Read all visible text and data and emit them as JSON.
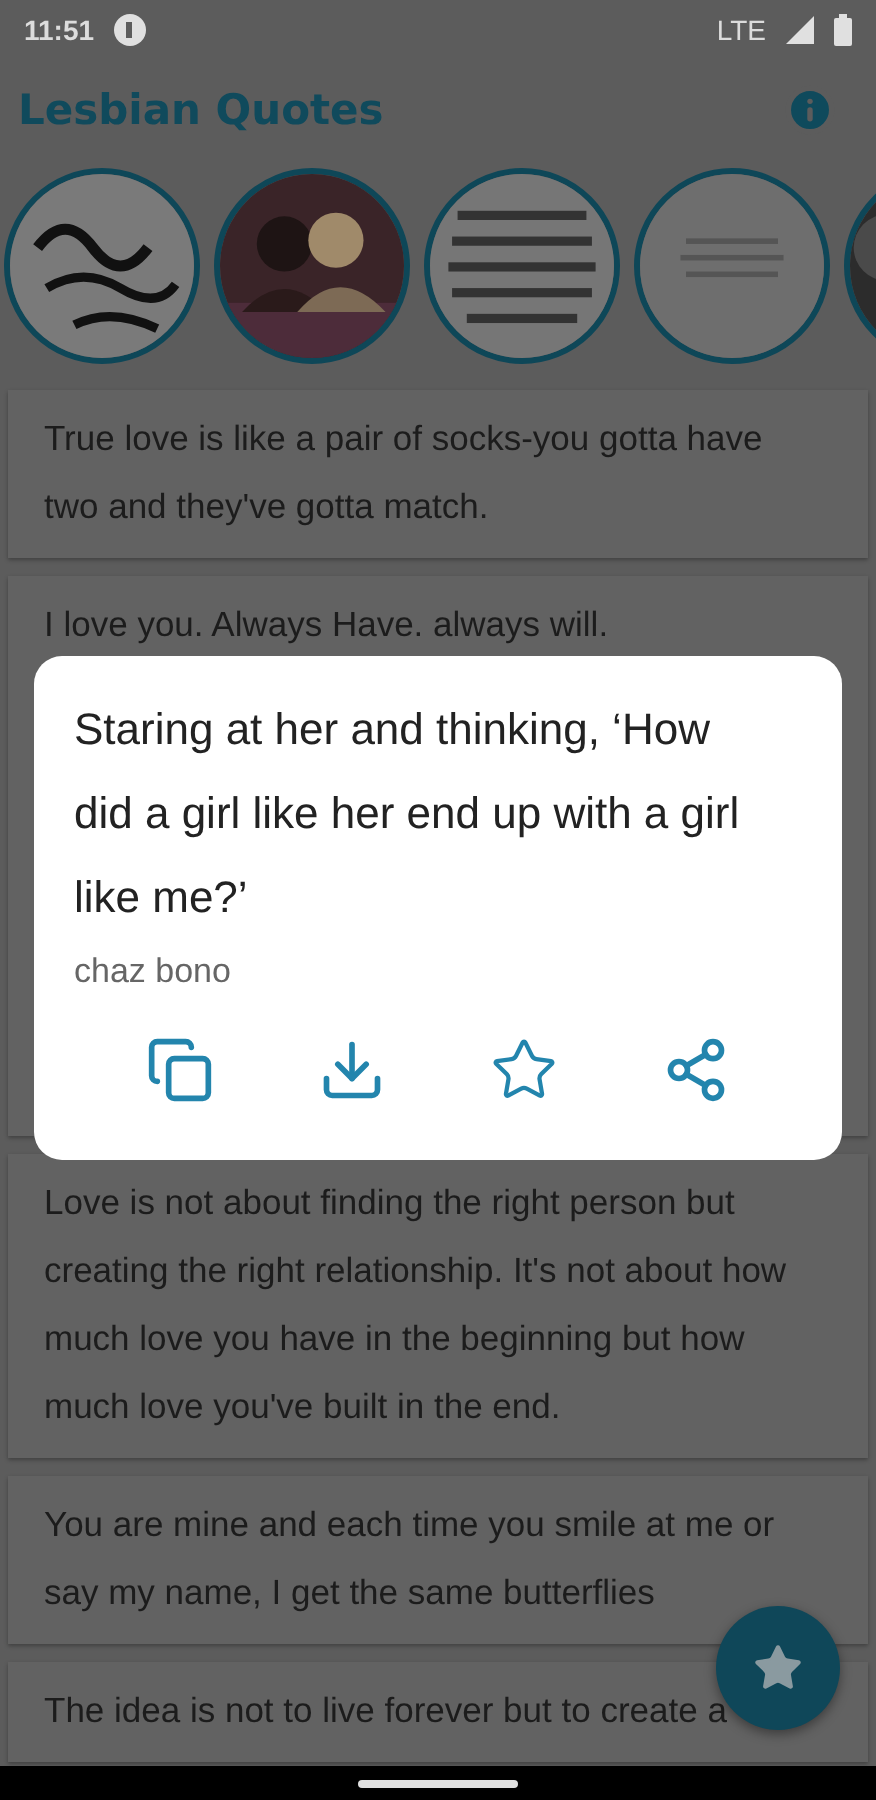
{
  "status_bar": {
    "time": "11:51",
    "network": "LTE"
  },
  "app_bar": {
    "title": "Lesbian Quotes"
  },
  "quotes": [
    {
      "text": "True love is like a pair of socks-you gotta have two and they've gotta match."
    },
    {
      "text": "I love you. Always Have. always will."
    },
    {
      "text": "Love is not about finding the right person but creating the right relationship. It's not about how much love you have in the beginning but how much love you've built in the end."
    },
    {
      "text": "You are mine and each time you smile at me or say my name, I get the same butterflies"
    },
    {
      "text": "The idea is not to live forever but to create a"
    }
  ],
  "dialog": {
    "quote": "Staring at her and thinking, ‘How did a girl like her end up with a girl like me?’",
    "author": "chaz bono",
    "actions": [
      {
        "kind": "copy"
      },
      {
        "kind": "download"
      },
      {
        "kind": "favorite"
      },
      {
        "kind": "share"
      }
    ]
  }
}
